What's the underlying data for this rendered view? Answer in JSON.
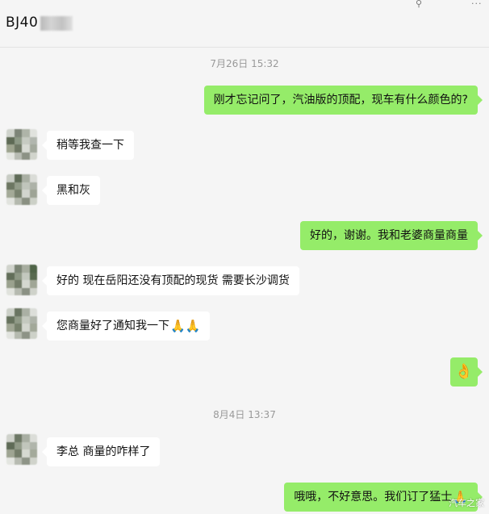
{
  "header": {
    "title": "BJ40"
  },
  "messages": [
    {
      "type": "timestamp",
      "text": "7月26日 15:32"
    },
    {
      "type": "out",
      "text": "刚才忘记问了，汽油版的顶配，现车有什么颜色的?"
    },
    {
      "type": "in",
      "text": "稍等我查一下"
    },
    {
      "type": "in",
      "text": "黑和灰"
    },
    {
      "type": "out",
      "text": "好的，谢谢。我和老婆商量商量"
    },
    {
      "type": "in",
      "text": "好的  现在岳阳还没有顶配的现货  需要长沙调货"
    },
    {
      "type": "in",
      "text": "您商量好了通知我一下",
      "emoji": "pray-icon"
    },
    {
      "type": "out",
      "emoji": "ok-hand-icon"
    },
    {
      "type": "timestamp",
      "text": "8月4日 13:37"
    },
    {
      "type": "in",
      "text": "李总  商量的咋样了"
    },
    {
      "type": "out",
      "text": "哦哦，不好意思。我们订了猛士",
      "emoji": "pray-icon"
    }
  ],
  "watermark": "汽车之家",
  "colors": {
    "background": "#f5f5f5",
    "outgoing_bubble": "#95ec69",
    "incoming_bubble": "#ffffff",
    "timestamp": "#999999"
  }
}
